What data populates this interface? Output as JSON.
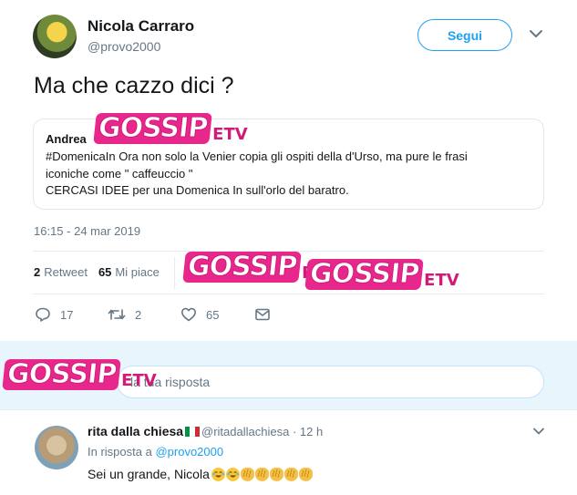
{
  "tweet": {
    "author_name": "Nicola Carraro",
    "author_handle": "@provo2000",
    "follow_label": "Segui",
    "text": "Ma che cazzo dici ?",
    "quoted": {
      "author": "Andrea",
      "lines": [
        "#DomenicaIn Ora non solo la Venier copia gli ospiti della d'Urso, ma pure le frasi",
        "iconiche come \" caffeuccio \"",
        "CERCASI IDEE per una Domenica In sull'orlo del baratro."
      ]
    },
    "timestamp": "16:15 - 24 mar 2019",
    "retweets_count": "2",
    "retweets_label": "Retweet",
    "likes_count": "65",
    "likes_label": "Mi piace",
    "actions": {
      "replies": "17",
      "retweets": "2",
      "likes": "65"
    }
  },
  "composer": {
    "placeholder": "la tua risposta"
  },
  "reply": {
    "name": "rita dalla chiesa",
    "handle": "@ritadallachiesa",
    "time": "· 12 h",
    "reply_to_prefix": "In risposta a",
    "reply_to_handle": "@provo2000",
    "text": "Sei un grande, Nicola",
    "emoji_sequence": [
      "joy",
      "joy",
      "clap",
      "clap",
      "clap",
      "clap",
      "clap"
    ]
  },
  "watermark": {
    "brand": "GOSSIP",
    "suffix": "ETV"
  },
  "colors": {
    "accent": "#1da1f2",
    "secondary_text": "#657786",
    "watermark_pink": "#e8278c"
  }
}
